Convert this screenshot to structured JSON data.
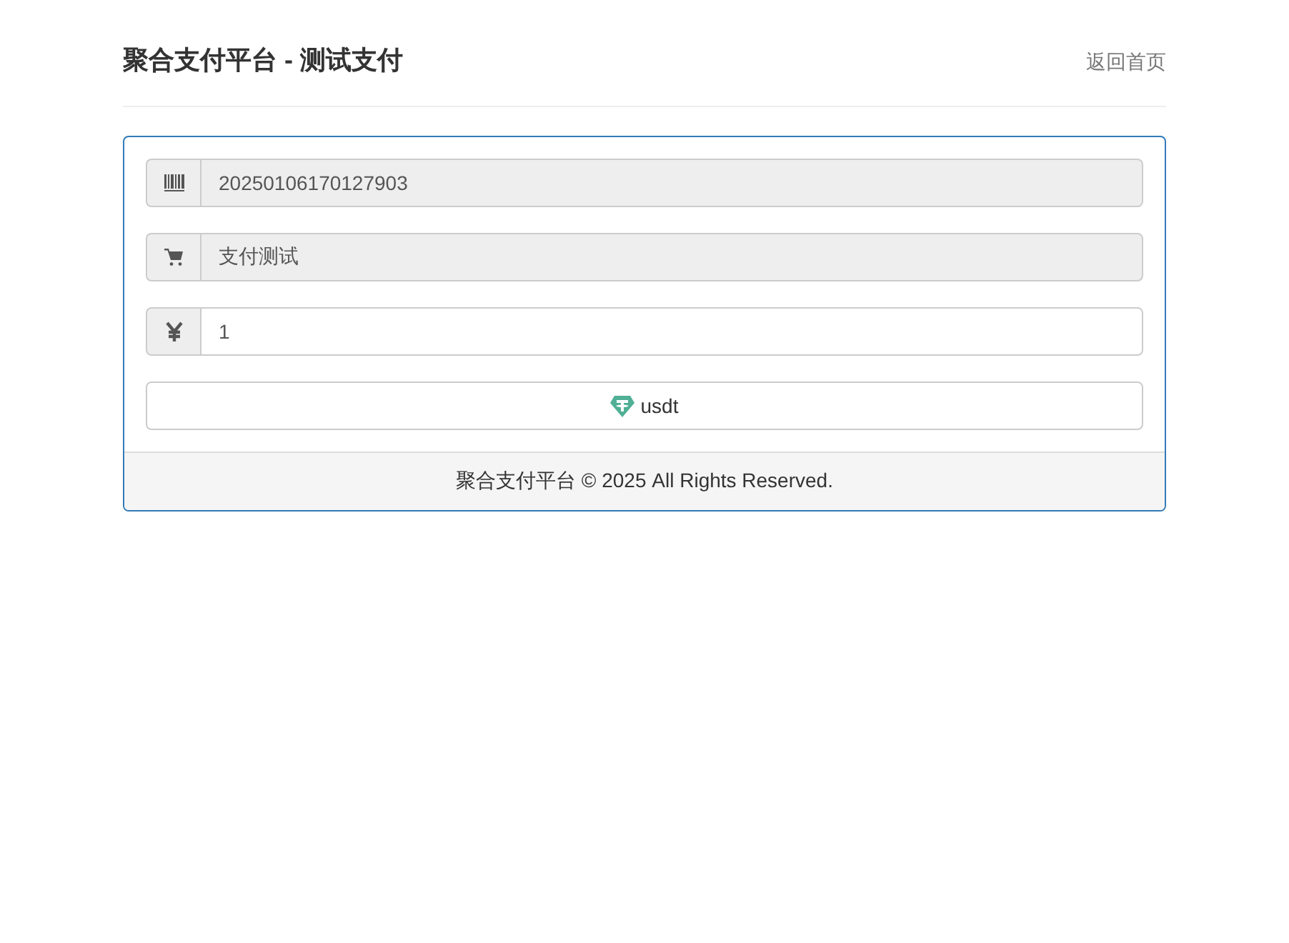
{
  "header": {
    "title": "聚合支付平台 - 测试支付",
    "home_link": "返回首页"
  },
  "fields": [
    {
      "kind": "barcode",
      "value": "20250106170127903",
      "disabled": true
    },
    {
      "kind": "cart",
      "value": "支付测试",
      "disabled": true
    },
    {
      "kind": "yen",
      "value": "1",
      "disabled": false
    }
  ],
  "pay_button": {
    "label": "usdt"
  },
  "footer": {
    "text": "聚合支付平台 © 2025 All Rights Reserved."
  }
}
